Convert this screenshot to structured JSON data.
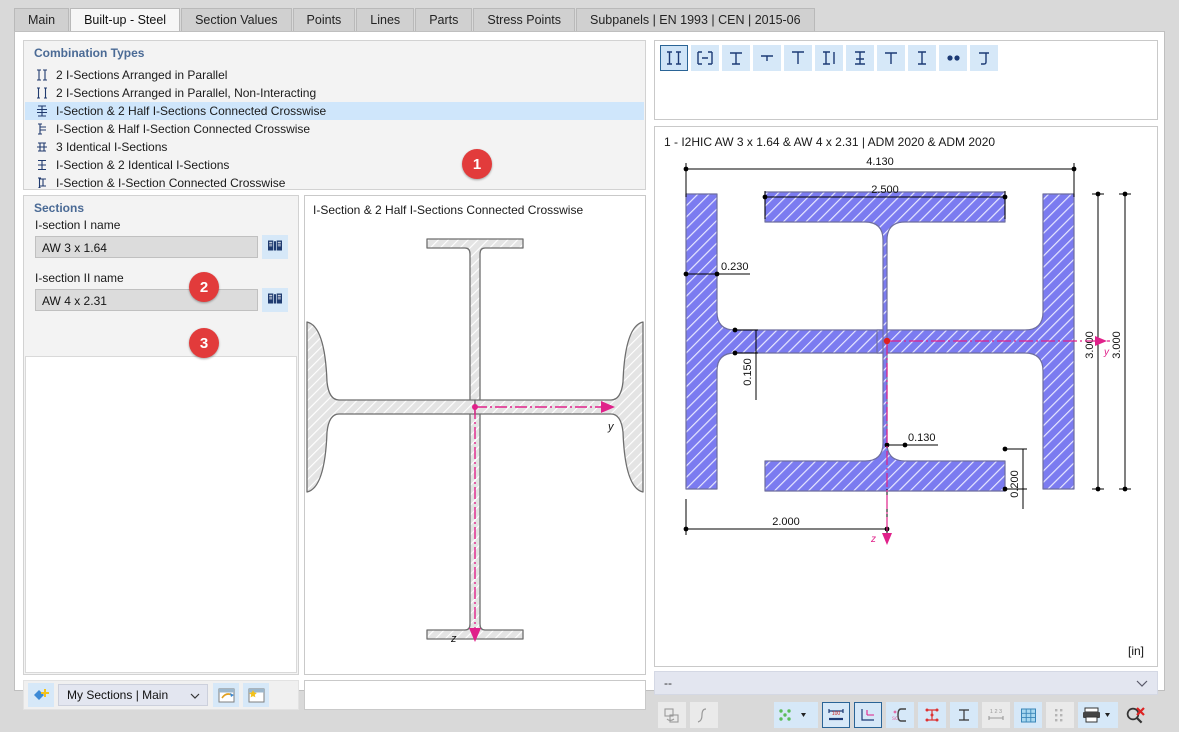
{
  "window": {
    "tabs": [
      {
        "label": "Main",
        "active": false
      },
      {
        "label": "Built-up - Steel",
        "active": true
      },
      {
        "label": "Section Values",
        "active": false
      },
      {
        "label": "Points",
        "active": false
      },
      {
        "label": "Lines",
        "active": false
      },
      {
        "label": "Parts",
        "active": false
      },
      {
        "label": "Stress Points",
        "active": false
      },
      {
        "label": "Subpanels | EN 1993 | CEN | 2015-06",
        "active": false
      }
    ]
  },
  "combination": {
    "title": "Combination Types",
    "items": [
      {
        "label": "2 I-Sections Arranged in Parallel",
        "icon": "two-i-parallel-icon",
        "selected": false
      },
      {
        "label": "2 I-Sections Arranged in Parallel, Non-Interacting",
        "icon": "two-i-parallel-noninteracting-icon",
        "selected": false
      },
      {
        "label": "I-Section & 2 Half I-Sections Connected Crosswise",
        "icon": "i-and-two-half-i-crosswise-icon",
        "selected": true
      },
      {
        "label": "I-Section & Half I-Section Connected Crosswise",
        "icon": "i-and-half-i-crosswise-icon",
        "selected": false
      },
      {
        "label": "3 Identical I-Sections",
        "icon": "three-identical-i-icon",
        "selected": false
      },
      {
        "label": "I-Section & 2 Identical I-Sections",
        "icon": "i-and-two-identical-i-icon",
        "selected": false
      },
      {
        "label": "I-Section & I-Section Connected Crosswise",
        "icon": "i-and-i-crosswise-icon",
        "selected": false
      }
    ]
  },
  "sections": {
    "title": "Sections",
    "field1": {
      "label": "I-section I name",
      "value": "AW 3 x 1.64",
      "placeholder": ""
    },
    "field2": {
      "label": "I-section II name",
      "value": "AW 4 x 2.31",
      "placeholder": ""
    },
    "library_button_tooltip": "Section library"
  },
  "preview": {
    "title": "I-Section & 2 Half I-Sections Connected Crosswise",
    "axis_y": "y",
    "axis_z": "z"
  },
  "library_bar": {
    "selected": "My Sections | Main"
  },
  "right": {
    "shape_buttons": [
      {
        "name": "shape-two-i-parallel",
        "selected": true
      },
      {
        "name": "shape-two-i-rotated",
        "selected": false
      },
      {
        "name": "shape-t-up",
        "selected": false
      },
      {
        "name": "shape-t-small",
        "selected": false
      },
      {
        "name": "shape-t-tall",
        "selected": false
      },
      {
        "name": "shape-i-and-bar",
        "selected": false
      },
      {
        "name": "shape-i-cross",
        "selected": false
      },
      {
        "name": "shape-i-plain",
        "selected": false
      },
      {
        "name": "shape-i-narrow",
        "selected": false
      },
      {
        "name": "shape-two-dots",
        "selected": false
      },
      {
        "name": "shape-j",
        "selected": false
      }
    ],
    "title": "1 - I2HIC AW 3 x 1.64 & AW 4 x 2.31 | ADM 2020 & ADM 2020",
    "unit": "[in]",
    "combo_value": "--"
  },
  "drawing": {
    "dim_total_width": "4.130",
    "dim_inner_width": "2.500",
    "dim_flange_thickness_left": "0.230",
    "dim_web_height_mark": "0.150",
    "dim_web_thickness": "0.130",
    "dim_flange_thickness_bottom": "0.200",
    "dim_bottom_width": "2.000",
    "dim_height_inner": "3.000",
    "dim_height_outer": "3.000",
    "axis_y": "y",
    "axis_z": "z"
  },
  "badges": [
    {
      "number": "1"
    },
    {
      "number": "2"
    },
    {
      "number": "3"
    }
  ],
  "colors": {
    "accent_blue": "#6a6ae8",
    "selection": "#cfe6fb",
    "badge_red": "#e23b3b",
    "axis_magenta": "#e0218a",
    "panel_title": "#4a6a95"
  }
}
